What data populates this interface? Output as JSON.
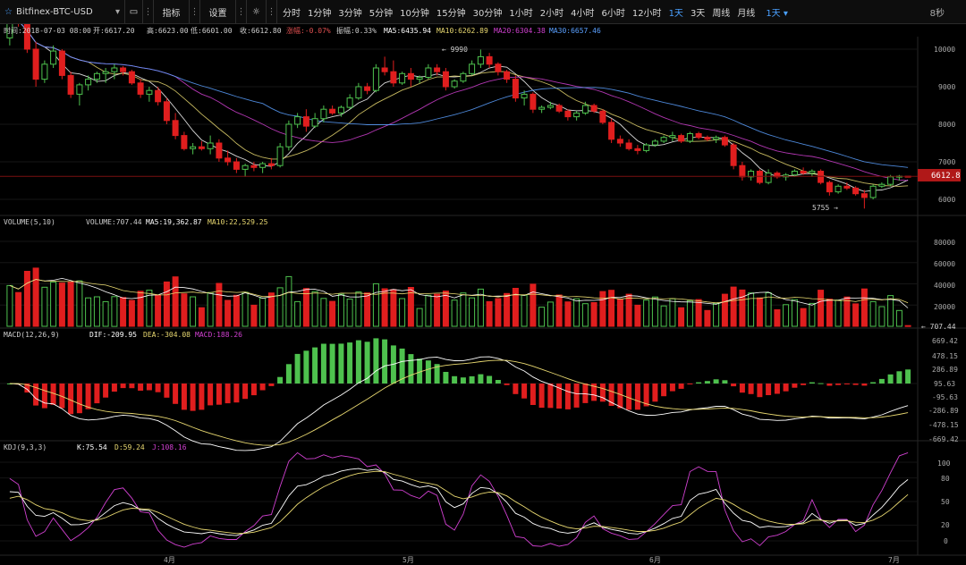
{
  "toolbar": {
    "symbol": "Bitfinex-BTC-USD",
    "indicators_label": "指标",
    "settings_label": "设置",
    "periods": [
      "分时",
      "1分钟",
      "3分钟",
      "5分钟",
      "10分钟",
      "15分钟",
      "30分钟",
      "1小时",
      "2小时",
      "4小时",
      "6小时",
      "12小时",
      "1天",
      "3天",
      "周线",
      "月线"
    ],
    "active_period": "1天",
    "period_dropdown": "1天",
    "refresh": "8秒"
  },
  "info": {
    "time": "时间:2018-07-03 08:00",
    "open": "开:6617.20",
    "high": "高:6623.00",
    "low": "低:6601.00",
    "close": "收:6612.80",
    "change": "涨幅:-0.07%",
    "amplitude": "振幅:0.33%",
    "ma5": "MA5:6435.94",
    "ma10": "MA10:6262.89",
    "ma20": "MA20:6304.38",
    "ma30": "MA30:6657.46"
  },
  "price_axis": [
    "10000",
    "9000",
    "8000",
    "7000",
    "6000"
  ],
  "current_price": "6612.8",
  "high_marker": "← 9990",
  "low_marker": "5755 →",
  "volume": {
    "label": "VOLUME(5,10)",
    "value": "VOLUME:707.44",
    "ma5": "MA5:19,362.87",
    "ma10": "MA10:22,529.25",
    "axis": [
      "80000",
      "60000",
      "40000",
      "20000"
    ],
    "current": "← 707.44"
  },
  "macd": {
    "label": "MACD(12,26,9)",
    "dif": "DIF:-209.95",
    "dea": "DEA:-304.08",
    "macd": "MACD:188.26",
    "axis": [
      "669.42",
      "478.15",
      "286.89",
      "95.63",
      "-95.63",
      "-286.89",
      "-478.15",
      "-669.42"
    ]
  },
  "kdj": {
    "label": "KDJ(9,3,3)",
    "k": "K:75.54",
    "d": "D:59.24",
    "j": "J:108.16",
    "axis": [
      "100",
      "80",
      "50",
      "20",
      "0"
    ]
  },
  "months": [
    "4月",
    "5月",
    "6月",
    "7月"
  ],
  "colors": {
    "up": "#4ec14e",
    "down": "#e01e1e",
    "ma5": "#ffffff",
    "ma10": "#e8d870",
    "ma20": "#d040d0",
    "ma30": "#5aa0ff"
  },
  "chart_data": {
    "type": "candlestick",
    "x_start": "2018-03-01",
    "x_end": "2018-07-03",
    "ohlc": [
      [
        10300,
        10900,
        10100,
        10800
      ],
      [
        10800,
        11100,
        10600,
        10700
      ],
      [
        10700,
        10800,
        9900,
        10000
      ],
      [
        10000,
        10200,
        9000,
        9200
      ],
      [
        9200,
        9700,
        9100,
        9600
      ],
      [
        9600,
        10100,
        9500,
        9950
      ],
      [
        9950,
        10000,
        9200,
        9300
      ],
      [
        9300,
        9400,
        8700,
        8800
      ],
      [
        8800,
        9100,
        8500,
        9050
      ],
      [
        9050,
        9300,
        8900,
        9200
      ],
      [
        9200,
        9400,
        9100,
        9350
      ],
      [
        9350,
        9500,
        9100,
        9400
      ],
      [
        9400,
        9600,
        9200,
        9500
      ],
      [
        9500,
        9550,
        9300,
        9400
      ],
      [
        9400,
        9450,
        9050,
        9100
      ],
      [
        9100,
        9200,
        8700,
        8800
      ],
      [
        8800,
        9000,
        8600,
        8900
      ],
      [
        8900,
        9000,
        8500,
        8600
      ],
      [
        8600,
        8700,
        8000,
        8100
      ],
      [
        8100,
        8300,
        7600,
        7700
      ],
      [
        7700,
        7800,
        7300,
        7350
      ],
      [
        7350,
        7500,
        7200,
        7400
      ],
      [
        7400,
        7550,
        7300,
        7350
      ],
      [
        7350,
        7700,
        7200,
        7500
      ],
      [
        7500,
        7600,
        7000,
        7100
      ],
      [
        7100,
        7300,
        6900,
        7000
      ],
      [
        7000,
        7100,
        6700,
        6800
      ],
      [
        6800,
        6950,
        6600,
        6900
      ],
      [
        6900,
        7000,
        6750,
        6850
      ],
      [
        6850,
        7000,
        6700,
        6950
      ],
      [
        6950,
        7100,
        6800,
        6900
      ],
      [
        6900,
        7500,
        6850,
        7400
      ],
      [
        7400,
        8100,
        7300,
        8000
      ],
      [
        8000,
        8300,
        7900,
        8200
      ],
      [
        8200,
        8400,
        7800,
        7950
      ],
      [
        7950,
        8300,
        7900,
        8150
      ],
      [
        8150,
        8500,
        8050,
        8400
      ],
      [
        8400,
        8500,
        8250,
        8300
      ],
      [
        8300,
        8500,
        8200,
        8450
      ],
      [
        8450,
        8800,
        8400,
        8700
      ],
      [
        8700,
        9100,
        8650,
        9000
      ],
      [
        9000,
        9100,
        8800,
        8900
      ],
      [
        8900,
        9600,
        8850,
        9500
      ],
      [
        9500,
        9800,
        9300,
        9400
      ],
      [
        9400,
        9700,
        9000,
        9100
      ],
      [
        9100,
        9400,
        9050,
        9350
      ],
      [
        9350,
        9500,
        9000,
        9200
      ],
      [
        9200,
        9300,
        9100,
        9250
      ],
      [
        9250,
        9600,
        9200,
        9500
      ],
      [
        9500,
        9600,
        9300,
        9400
      ],
      [
        9400,
        9500,
        8900,
        9000
      ],
      [
        9000,
        9200,
        8950,
        9150
      ],
      [
        9150,
        9400,
        9100,
        9350
      ],
      [
        9350,
        9700,
        9300,
        9600
      ],
      [
        9600,
        9990,
        9500,
        9800
      ],
      [
        9800,
        9900,
        9500,
        9600
      ],
      [
        9600,
        9650,
        9300,
        9400
      ],
      [
        9400,
        9450,
        9100,
        9200
      ],
      [
        9200,
        9300,
        8600,
        8700
      ],
      [
        8700,
        8900,
        8500,
        8800
      ],
      [
        8800,
        8850,
        8300,
        8400
      ],
      [
        8400,
        8500,
        8300,
        8450
      ],
      [
        8450,
        8600,
        8400,
        8500
      ],
      [
        8500,
        8550,
        8300,
        8350
      ],
      [
        8350,
        8400,
        8100,
        8200
      ],
      [
        8200,
        8350,
        8100,
        8300
      ],
      [
        8300,
        8600,
        8250,
        8500
      ],
      [
        8500,
        8550,
        8300,
        8350
      ],
      [
        8350,
        8400,
        8000,
        8050
      ],
      [
        8050,
        8150,
        7500,
        7600
      ],
      [
        7600,
        7700,
        7400,
        7500
      ],
      [
        7500,
        7600,
        7300,
        7350
      ],
      [
        7350,
        7450,
        7200,
        7300
      ],
      [
        7300,
        7500,
        7250,
        7450
      ],
      [
        7450,
        7600,
        7400,
        7550
      ],
      [
        7550,
        7700,
        7500,
        7650
      ],
      [
        7650,
        7800,
        7550,
        7700
      ],
      [
        7700,
        7750,
        7500,
        7550
      ],
      [
        7550,
        7800,
        7500,
        7750
      ],
      [
        7750,
        7800,
        7600,
        7650
      ],
      [
        7650,
        7700,
        7550,
        7600
      ],
      [
        7600,
        7700,
        7500,
        7650
      ],
      [
        7650,
        7700,
        7400,
        7450
      ],
      [
        7450,
        7500,
        6800,
        6900
      ],
      [
        6900,
        7000,
        6500,
        6600
      ],
      [
        6600,
        6800,
        6500,
        6750
      ],
      [
        6750,
        6800,
        6400,
        6450
      ],
      [
        6450,
        6800,
        6400,
        6700
      ],
      [
        6700,
        6750,
        6550,
        6600
      ],
      [
        6600,
        6700,
        6500,
        6650
      ],
      [
        6650,
        6800,
        6600,
        6750
      ],
      [
        6750,
        6850,
        6650,
        6700
      ],
      [
        6700,
        6800,
        6600,
        6750
      ],
      [
        6750,
        6800,
        6400,
        6450
      ],
      [
        6450,
        6500,
        6100,
        6200
      ],
      [
        6200,
        6400,
        6150,
        6350
      ],
      [
        6350,
        6450,
        6250,
        6300
      ],
      [
        6300,
        6350,
        6100,
        6150
      ],
      [
        6150,
        6250,
        5755,
        6050
      ],
      [
        6050,
        6400,
        6000,
        6350
      ],
      [
        6350,
        6450,
        6300,
        6400
      ],
      [
        6400,
        6650,
        6350,
        6600
      ],
      [
        6600,
        6650,
        6500,
        6617
      ],
      [
        6617,
        6623,
        6601,
        6612.8
      ]
    ]
  }
}
